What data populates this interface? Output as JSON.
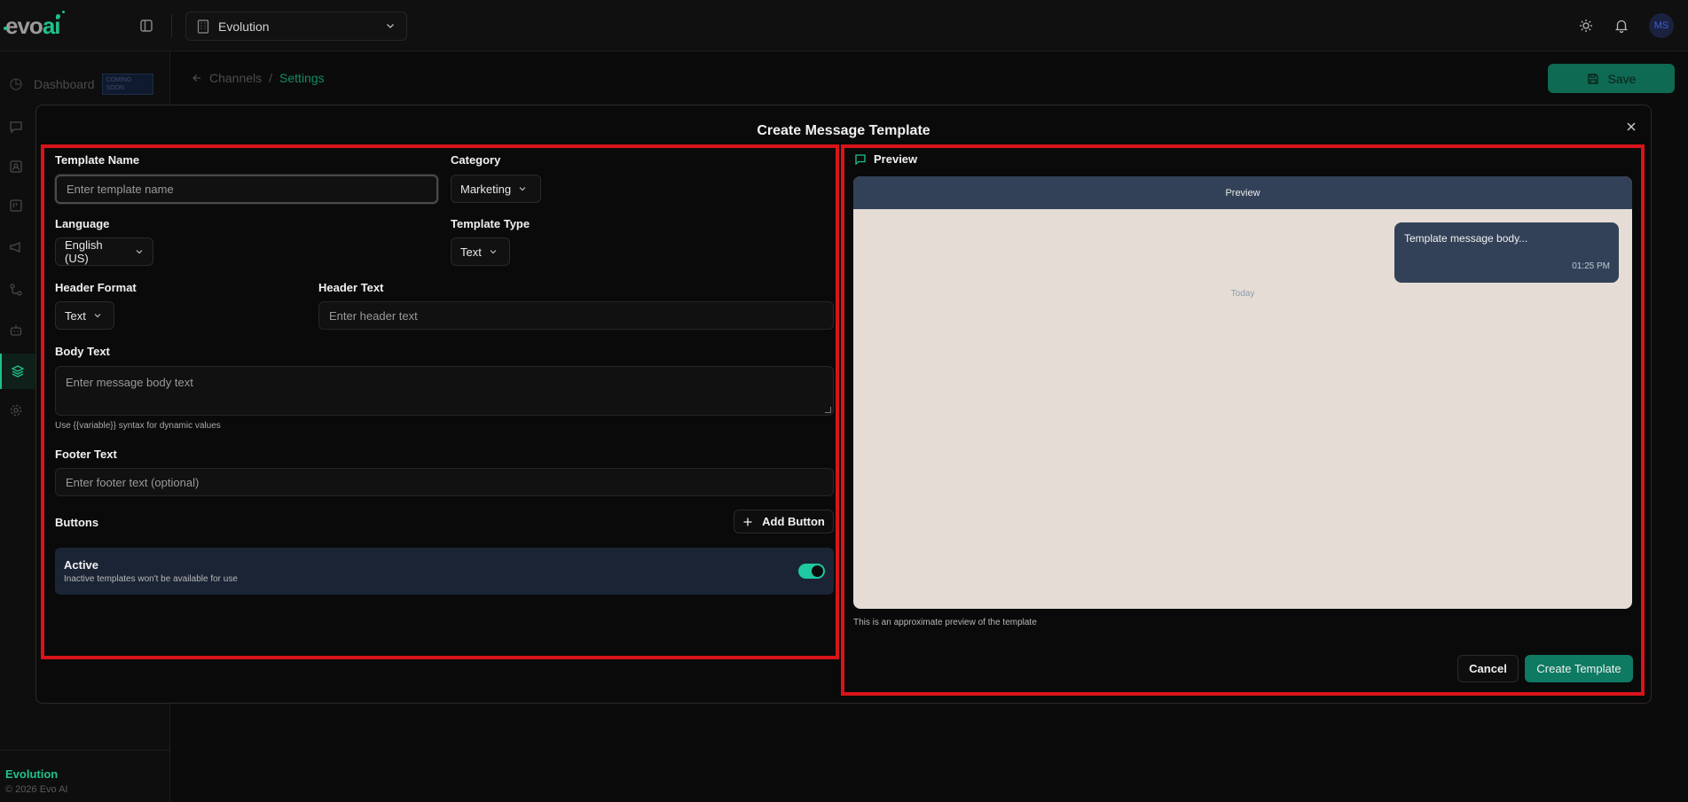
{
  "app": {
    "logo_text_evo": "evo",
    "logo_text_ai": "ai",
    "workspace": "Evolution",
    "avatar_initials": "MS"
  },
  "sidebar": {
    "dashboard_label": "Dashboard",
    "dashboard_badge": "COMING SOON",
    "footer_name": "Evolution",
    "footer_copyright": "© 2026 Evo AI"
  },
  "breadcrumb": {
    "parent": "Channels",
    "separator": "/",
    "current": "Settings"
  },
  "header": {
    "save_label": "Save"
  },
  "modal": {
    "title": "Create Message Template",
    "template_name_label": "Template Name",
    "template_name_placeholder": "Enter template name",
    "category_label": "Category",
    "category_value": "Marketing",
    "language_label": "Language",
    "language_value": "English (US)",
    "template_type_label": "Template Type",
    "template_type_value": "Text",
    "header_format_label": "Header Format",
    "header_format_value": "Text",
    "header_text_label": "Header Text",
    "header_text_placeholder": "Enter header text",
    "body_text_label": "Body Text",
    "body_text_placeholder": "Enter message body text",
    "body_hint": "Use {{variable}} syntax for dynamic values",
    "footer_text_label": "Footer Text",
    "footer_text_placeholder": "Enter footer text (optional)",
    "buttons_label": "Buttons",
    "add_button_label": "Add Button",
    "active_title": "Active",
    "active_subtitle": "Inactive templates won't be available for use",
    "preview_heading": "Preview",
    "preview_bar": "Preview",
    "preview_message": "Template message body...",
    "preview_time": "01:25 PM",
    "preview_today": "Today",
    "preview_note": "This is an approximate preview of the template",
    "cancel_label": "Cancel",
    "create_label": "Create Template"
  },
  "colors": {
    "accent": "#1ec28b",
    "primary_button": "#0e7a62",
    "highlight_box": "#d8141a",
    "chat_background": "#e5ddd5",
    "bubble": "#334158"
  }
}
